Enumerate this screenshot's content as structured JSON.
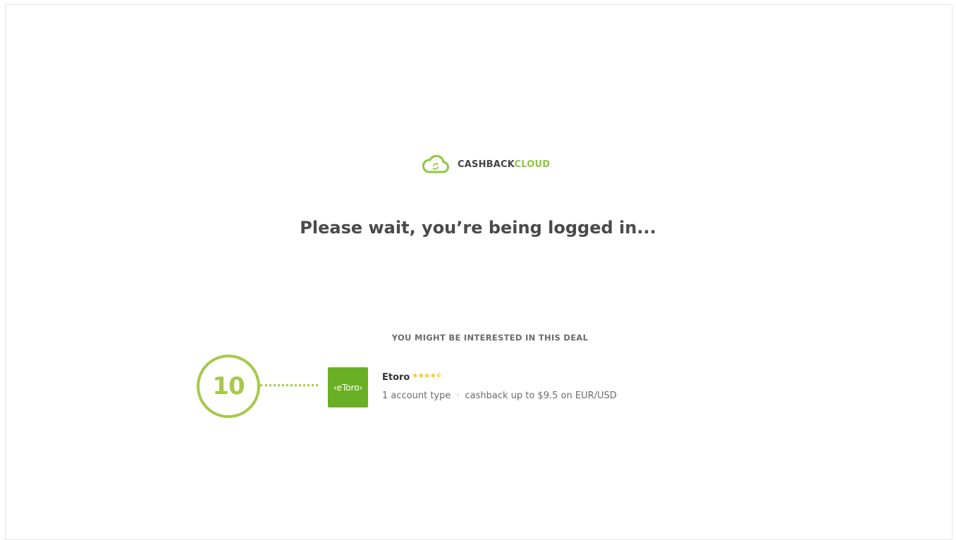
{
  "logo": {
    "name_part1": "CASHBACK",
    "name_part2": "CLOUD",
    "icon": "cloud-sync-icon"
  },
  "headline": "Please wait, you’re being logged in...",
  "deal_section": {
    "heading": "YOU MIGHT BE INTERESTED IN THIS DEAL",
    "step_badge": "10",
    "deal": {
      "logo_text": "‹eToro›",
      "name": "Etoro",
      "rating": 4.5,
      "rating_stars": "★★★★⯪",
      "account_types": "1 account type",
      "separator": "·",
      "cashback": "cashback up to $9.5 on EUR/USD"
    }
  },
  "colors": {
    "brand_green": "#8cc63f",
    "badge_green": "#a6c94a",
    "etoro_green": "#6ab024",
    "star_yellow": "#f5c518",
    "text_dark": "#4a4a4a"
  }
}
